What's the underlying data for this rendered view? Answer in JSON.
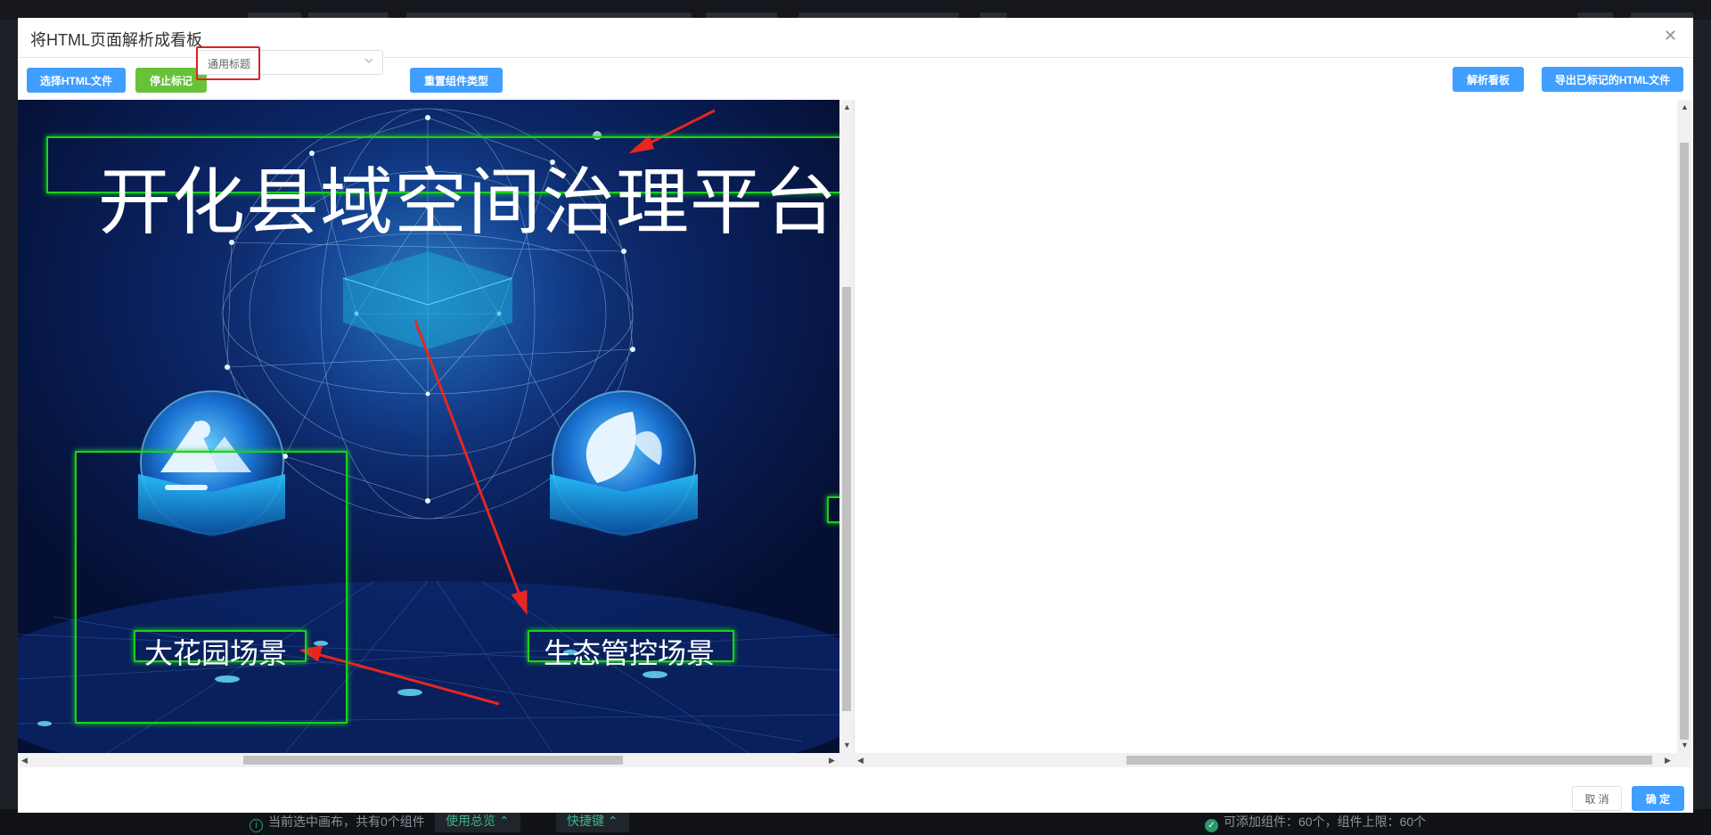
{
  "dialog": {
    "title": "将HTML页面解析成看板",
    "close_icon": "close-icon"
  },
  "toolbar": {
    "select_html_label": "选择HTML文件",
    "stop_mark_label": "停止标记",
    "component_select_value": "通用标题",
    "reset_type_label": "重置组件类型",
    "parse_board_label": "解析看板",
    "export_label": "导出已标记的HTML文件"
  },
  "preview": {
    "page_title": "开化县域空间治理平台",
    "scenes": [
      {
        "label": "大花园场景",
        "icon": "mountain-icon"
      },
      {
        "label": "生态管控场景",
        "icon": "leaf-icon"
      }
    ]
  },
  "footer": {
    "cancel_label": "取 消",
    "confirm_label": "确 定"
  },
  "background_app": {
    "status_text": "当前选中画布，共有0个组件",
    "usage_overview_label": "使用总览",
    "shortcut_label": "快捷键",
    "quota_text": "可添加组件：60个，组件上限：60个"
  },
  "colors": {
    "primary": "#409eff",
    "success": "#67c23a",
    "marker_green": "#19d21c",
    "annotation_red": "#e02020"
  }
}
